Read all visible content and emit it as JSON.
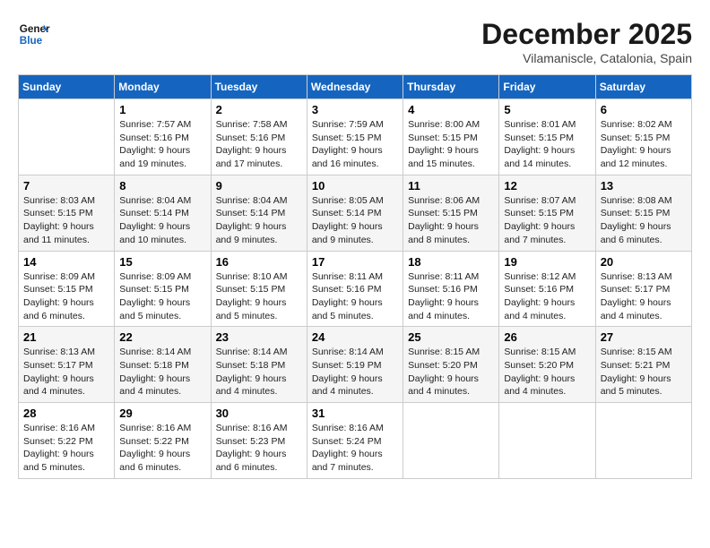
{
  "header": {
    "logo_line1": "General",
    "logo_line2": "Blue",
    "month": "December 2025",
    "location": "Vilamaniscle, Catalonia, Spain"
  },
  "weekdays": [
    "Sunday",
    "Monday",
    "Tuesday",
    "Wednesday",
    "Thursday",
    "Friday",
    "Saturday"
  ],
  "weeks": [
    [
      {
        "day": "",
        "info": ""
      },
      {
        "day": "1",
        "info": "Sunrise: 7:57 AM\nSunset: 5:16 PM\nDaylight: 9 hours\nand 19 minutes."
      },
      {
        "day": "2",
        "info": "Sunrise: 7:58 AM\nSunset: 5:16 PM\nDaylight: 9 hours\nand 17 minutes."
      },
      {
        "day": "3",
        "info": "Sunrise: 7:59 AM\nSunset: 5:15 PM\nDaylight: 9 hours\nand 16 minutes."
      },
      {
        "day": "4",
        "info": "Sunrise: 8:00 AM\nSunset: 5:15 PM\nDaylight: 9 hours\nand 15 minutes."
      },
      {
        "day": "5",
        "info": "Sunrise: 8:01 AM\nSunset: 5:15 PM\nDaylight: 9 hours\nand 14 minutes."
      },
      {
        "day": "6",
        "info": "Sunrise: 8:02 AM\nSunset: 5:15 PM\nDaylight: 9 hours\nand 12 minutes."
      }
    ],
    [
      {
        "day": "7",
        "info": "Sunrise: 8:03 AM\nSunset: 5:15 PM\nDaylight: 9 hours\nand 11 minutes."
      },
      {
        "day": "8",
        "info": "Sunrise: 8:04 AM\nSunset: 5:14 PM\nDaylight: 9 hours\nand 10 minutes."
      },
      {
        "day": "9",
        "info": "Sunrise: 8:04 AM\nSunset: 5:14 PM\nDaylight: 9 hours\nand 9 minutes."
      },
      {
        "day": "10",
        "info": "Sunrise: 8:05 AM\nSunset: 5:14 PM\nDaylight: 9 hours\nand 9 minutes."
      },
      {
        "day": "11",
        "info": "Sunrise: 8:06 AM\nSunset: 5:15 PM\nDaylight: 9 hours\nand 8 minutes."
      },
      {
        "day": "12",
        "info": "Sunrise: 8:07 AM\nSunset: 5:15 PM\nDaylight: 9 hours\nand 7 minutes."
      },
      {
        "day": "13",
        "info": "Sunrise: 8:08 AM\nSunset: 5:15 PM\nDaylight: 9 hours\nand 6 minutes."
      }
    ],
    [
      {
        "day": "14",
        "info": "Sunrise: 8:09 AM\nSunset: 5:15 PM\nDaylight: 9 hours\nand 6 minutes."
      },
      {
        "day": "15",
        "info": "Sunrise: 8:09 AM\nSunset: 5:15 PM\nDaylight: 9 hours\nand 5 minutes."
      },
      {
        "day": "16",
        "info": "Sunrise: 8:10 AM\nSunset: 5:15 PM\nDaylight: 9 hours\nand 5 minutes."
      },
      {
        "day": "17",
        "info": "Sunrise: 8:11 AM\nSunset: 5:16 PM\nDaylight: 9 hours\nand 5 minutes."
      },
      {
        "day": "18",
        "info": "Sunrise: 8:11 AM\nSunset: 5:16 PM\nDaylight: 9 hours\nand 4 minutes."
      },
      {
        "day": "19",
        "info": "Sunrise: 8:12 AM\nSunset: 5:16 PM\nDaylight: 9 hours\nand 4 minutes."
      },
      {
        "day": "20",
        "info": "Sunrise: 8:13 AM\nSunset: 5:17 PM\nDaylight: 9 hours\nand 4 minutes."
      }
    ],
    [
      {
        "day": "21",
        "info": "Sunrise: 8:13 AM\nSunset: 5:17 PM\nDaylight: 9 hours\nand 4 minutes."
      },
      {
        "day": "22",
        "info": "Sunrise: 8:14 AM\nSunset: 5:18 PM\nDaylight: 9 hours\nand 4 minutes."
      },
      {
        "day": "23",
        "info": "Sunrise: 8:14 AM\nSunset: 5:18 PM\nDaylight: 9 hours\nand 4 minutes."
      },
      {
        "day": "24",
        "info": "Sunrise: 8:14 AM\nSunset: 5:19 PM\nDaylight: 9 hours\nand 4 minutes."
      },
      {
        "day": "25",
        "info": "Sunrise: 8:15 AM\nSunset: 5:20 PM\nDaylight: 9 hours\nand 4 minutes."
      },
      {
        "day": "26",
        "info": "Sunrise: 8:15 AM\nSunset: 5:20 PM\nDaylight: 9 hours\nand 4 minutes."
      },
      {
        "day": "27",
        "info": "Sunrise: 8:15 AM\nSunset: 5:21 PM\nDaylight: 9 hours\nand 5 minutes."
      }
    ],
    [
      {
        "day": "28",
        "info": "Sunrise: 8:16 AM\nSunset: 5:22 PM\nDaylight: 9 hours\nand 5 minutes."
      },
      {
        "day": "29",
        "info": "Sunrise: 8:16 AM\nSunset: 5:22 PM\nDaylight: 9 hours\nand 6 minutes."
      },
      {
        "day": "30",
        "info": "Sunrise: 8:16 AM\nSunset: 5:23 PM\nDaylight: 9 hours\nand 6 minutes."
      },
      {
        "day": "31",
        "info": "Sunrise: 8:16 AM\nSunset: 5:24 PM\nDaylight: 9 hours\nand 7 minutes."
      },
      {
        "day": "",
        "info": ""
      },
      {
        "day": "",
        "info": ""
      },
      {
        "day": "",
        "info": ""
      }
    ]
  ]
}
